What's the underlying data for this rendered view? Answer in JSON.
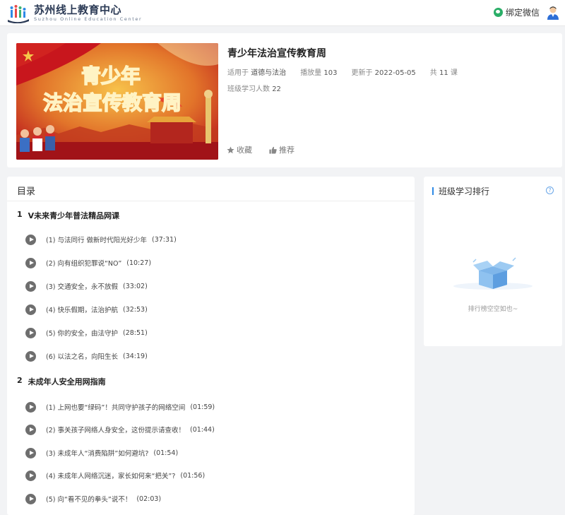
{
  "header": {
    "logo_cn": "苏州线上教育中心",
    "logo_en": "Suzhou Online Education Center",
    "wechat_label": "绑定微信"
  },
  "course": {
    "cover_line1": "青少年",
    "cover_line2": "法治宣传教育周",
    "title": "青少年法治宣传教育周",
    "meta": {
      "subject_label": "适用于",
      "subject_value": "道德与法治",
      "plays_label": "播放量",
      "plays_value": "103",
      "updated_label": "更新于",
      "updated_value": "2022-05-05",
      "count_prefix": "共",
      "count_value": "11",
      "count_suffix": "课",
      "learners_label": "班级学习人数",
      "learners_value": "22"
    },
    "actions": {
      "favorite": "收藏",
      "recommend": "推荐"
    }
  },
  "catalog": {
    "title": "目录",
    "chapters": [
      {
        "num": "1",
        "title": "V未来青少年普法精品网课",
        "lessons": [
          {
            "label": "(1) 与法同行 做新时代阳光好少年",
            "duration": "(37:31)"
          },
          {
            "label": "(2) 向有组织犯罪说“NO”",
            "duration": "(10:27)"
          },
          {
            "label": "(3) 交通安全，永不放假",
            "duration": "(33:02)"
          },
          {
            "label": "(4) 快乐假期，法治护航",
            "duration": "(32:53)"
          },
          {
            "label": "(5) 你的安全，由法守护",
            "duration": "(28:51)"
          },
          {
            "label": "(6) 以法之名，向阳生长",
            "duration": "(34:19)"
          }
        ]
      },
      {
        "num": "2",
        "title": "未成年人安全用网指南",
        "lessons": [
          {
            "label": "(1) 上网也要“绿码”！共同守护孩子的网络空间",
            "duration": "(01:59)"
          },
          {
            "label": "(2) 事关孩子网络人身安全，这份提示请查收！",
            "duration": "(01:44)"
          },
          {
            "label": "(3) 未成年人“消费陷阱”如何避坑?",
            "duration": "(01:54)"
          },
          {
            "label": "(4) 未成年人网络沉迷，家长如何来“把关”?",
            "duration": "(01:56)"
          },
          {
            "label": "(5) 向“看不见的拳头”说不！",
            "duration": "(02:03)"
          }
        ]
      }
    ]
  },
  "ranking": {
    "title": "班级学习排行",
    "help_glyph": "?",
    "empty_text": "排行榜空空如也~"
  },
  "colors": {
    "accent": "#2e8ae6",
    "wechat": "#2aae67",
    "cover_red": "#c8161d",
    "cover_gold": "#f5c84a"
  }
}
